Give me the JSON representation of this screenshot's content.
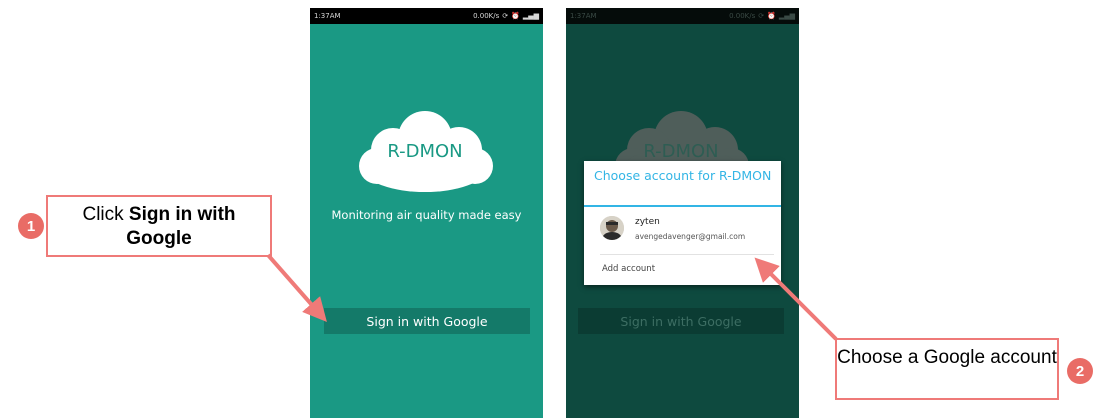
{
  "phone1": {
    "status": {
      "time": "1:37AM",
      "speed": "0.00K/s"
    },
    "logo_text": "R-DMON",
    "tagline": "Monitoring air quality made easy",
    "signin_label": "Sign in with Google"
  },
  "phone2": {
    "status": {
      "time": "1:37AM",
      "speed": "0.00K/s"
    },
    "logo_text": "R-DMON",
    "signin_label": "Sign in with Google",
    "dialog": {
      "title": "Choose account for R-DMON",
      "account": {
        "name": "zyten",
        "email": "avengedavenger@gmail.com"
      },
      "add_account_label": "Add account"
    }
  },
  "step1": {
    "badge": "1",
    "text_before": "Click ",
    "text_bold": "Sign in with Google"
  },
  "step2": {
    "badge": "2",
    "text": "Choose a Google account"
  },
  "colors": {
    "phone1_bg": "#1a9984",
    "phone2_bg": "#0e4a3f",
    "dialog_title": "#33b5e5",
    "callout_border": "#ef7a78",
    "badge": "#e96c66"
  }
}
